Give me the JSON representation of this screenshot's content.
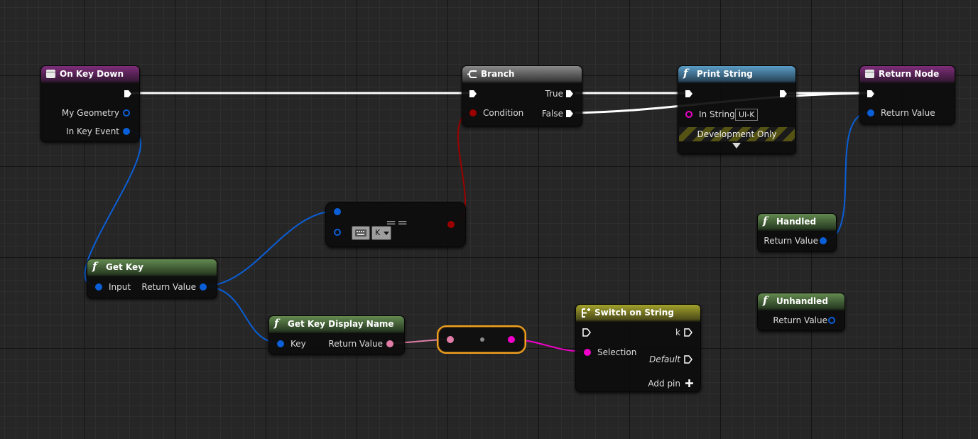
{
  "nodes": {
    "on_key_down": {
      "title": "On Key Down",
      "pins": {
        "my_geometry": "My Geometry",
        "in_key_event": "In Key Event"
      }
    },
    "branch": {
      "title": "Branch",
      "pins": {
        "condition": "Condition",
        "true": "True",
        "false": "False"
      }
    },
    "print_string": {
      "title": "Print String",
      "pins": {
        "in_string": "In String"
      },
      "in_string_value": "UI-K",
      "development_only": "Development Only"
    },
    "return_node": {
      "title": "Return Node",
      "pins": {
        "return_value": "Return Value"
      }
    },
    "equals": {
      "label": "==",
      "key_value": "K"
    },
    "get_key": {
      "title": "Get Key",
      "pins": {
        "input": "Input",
        "return_value": "Return Value"
      }
    },
    "handled": {
      "title": "Handled",
      "pins": {
        "return_value": "Return Value"
      }
    },
    "unhandled": {
      "title": "Unhandled",
      "pins": {
        "return_value": "Return Value"
      }
    },
    "get_key_display_name": {
      "title": "Get Key Display Name",
      "pins": {
        "key": "Key",
        "return_value": "Return Value"
      }
    },
    "switch_on_string": {
      "title": "Switch on String",
      "pins": {
        "k": "k",
        "selection": "Selection",
        "default": "Default",
        "add_pin": "Add pin"
      }
    }
  },
  "colors": {
    "exec": "#ffffff",
    "struct_blue": "#0a5fd8",
    "bool_red": "#9a0000",
    "string_magenta": "#f000c8",
    "text_pink": "#e07ea8",
    "highlight": "#f0a020"
  },
  "icons": {
    "event": "event-icon",
    "branch": "branch-icon",
    "function": "function-icon",
    "switch": "switch-icon",
    "keyboard": "keyboard-icon"
  }
}
